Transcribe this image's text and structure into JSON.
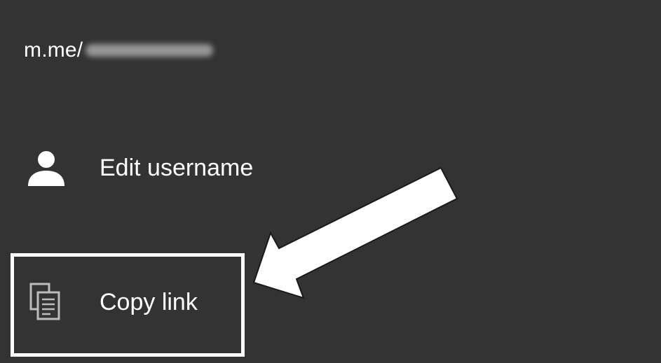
{
  "profile_link": {
    "prefix": "m.me/"
  },
  "menu": {
    "items": [
      {
        "label": "Edit username",
        "icon": "person-icon"
      },
      {
        "label": "Copy link",
        "icon": "copy-icon"
      }
    ]
  },
  "colors": {
    "background": "#333333",
    "text": "#ffffff",
    "icon_primary": "#ffffff",
    "icon_secondary": "#bdbdbd",
    "annotation": "#ffffff"
  }
}
